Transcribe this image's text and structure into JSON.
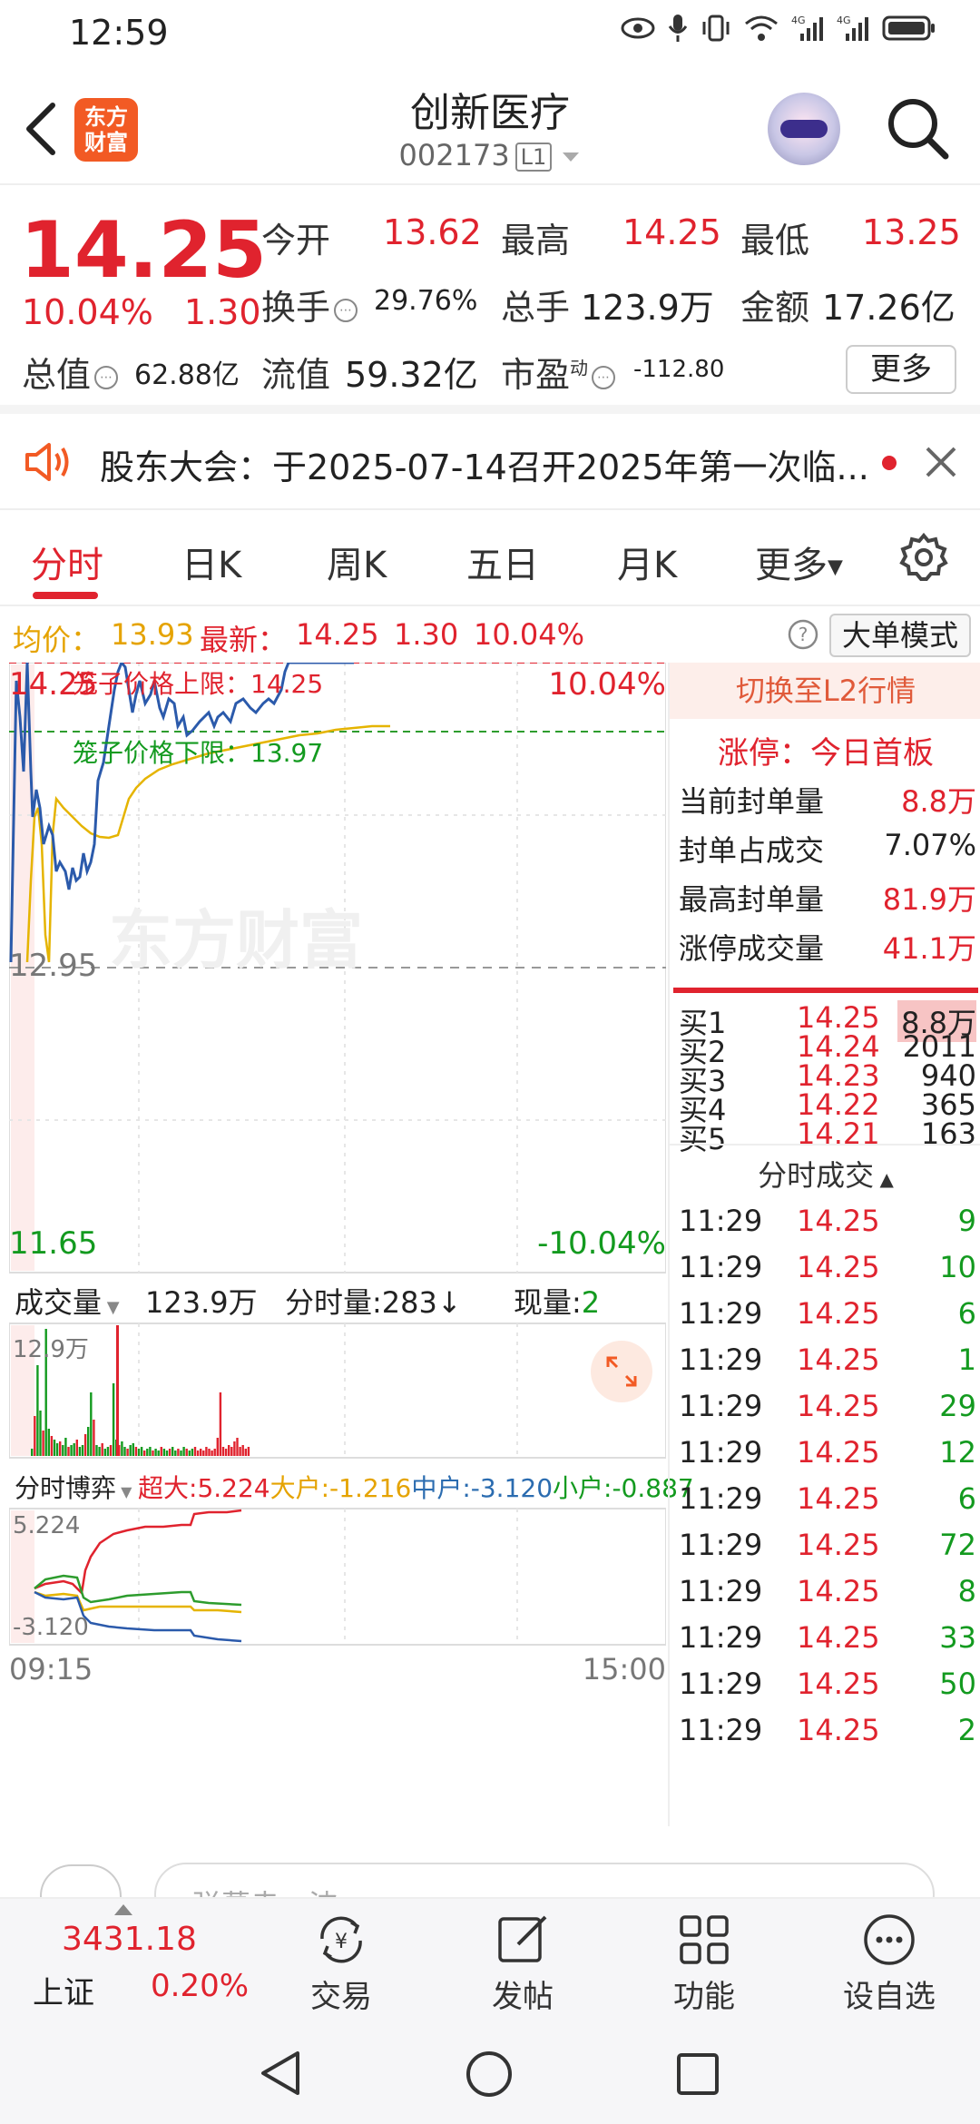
{
  "status": {
    "time": "12:59",
    "net1": "4G",
    "net2": "4G"
  },
  "header": {
    "logo_line1": "东方",
    "logo_line2": "财富",
    "stock_name": "创新医疗",
    "stock_code": "002173",
    "level": "L1"
  },
  "quote": {
    "price": "14.25",
    "change_pct": "10.04%",
    "change": "1.30",
    "open_label": "今开",
    "open": "13.62",
    "high_label": "最高",
    "high": "14.25",
    "low_label": "最低",
    "low": "13.25",
    "turnover_label": "换手",
    "turnover": "29.76%",
    "volume_label": "总手",
    "volume": "123.9万",
    "amount_label": "金额",
    "amount": "17.26亿",
    "mktcap_label": "总值",
    "mktcap": "62.88亿",
    "float_label": "流值",
    "float_cap": "59.32亿",
    "pe_label": "市盈",
    "pe_sup": "动",
    "pe": "-112.80",
    "more": "更多"
  },
  "notice": {
    "text": "股东大会：于2025-07-14召开2025年第一次临..."
  },
  "tabs": [
    "分时",
    "日K",
    "周K",
    "五日",
    "月K",
    "更多"
  ],
  "summary": {
    "avg_label": "均价：",
    "avg": "13.93",
    "latest_label": "最新：",
    "latest": "14.25",
    "change": "1.30",
    "pct": "10.04%",
    "bigorder": "大单模式"
  },
  "chart": {
    "price_top": "14.25",
    "price_mid": "12.95",
    "price_bottom": "11.65",
    "pct_top": "10.04%",
    "pct_bottom": "-10.04%",
    "cage_upper_label": "笼子价格上限：",
    "cage_upper": "14.25",
    "cage_lower_label": "笼子价格下限：",
    "cage_lower": "13.97",
    "watermark": "东方财富",
    "vol_selector": "成交量",
    "vol_total": "123.9万",
    "vol_minute_label": "分时量:",
    "vol_minute": "283",
    "vol_now_label": "现量:",
    "vol_now": "2",
    "vol_max": "12.9万",
    "flow_selector": "分时博弈",
    "flow_super_label": "超大:",
    "flow_super": "5.224",
    "flow_large_label": "大户:",
    "flow_large": "-1.216",
    "flow_mid_label": "中户:",
    "flow_mid": "-3.120",
    "flow_small_label": "小户:",
    "flow_small": "-0.887",
    "flow_top": "5.224",
    "flow_bottom": "-3.120",
    "time_start": "09:15",
    "time_end": "15:00"
  },
  "side": {
    "switch_l2": "切换至L2行情",
    "limit_title": "涨停：今日首板",
    "stats": [
      {
        "label": "当前封单量",
        "value": "8.8万"
      },
      {
        "label": "封单占成交",
        "value": "7.07%"
      },
      {
        "label": "最高封单量",
        "value": "81.9万"
      },
      {
        "label": "涨停成交量",
        "value": "41.1万"
      }
    ],
    "bids": [
      {
        "label": "买1",
        "price": "14.25",
        "vol": "8.8万"
      },
      {
        "label": "买2",
        "price": "14.24",
        "vol": "2011"
      },
      {
        "label": "买3",
        "price": "14.23",
        "vol": "940"
      },
      {
        "label": "买4",
        "price": "14.22",
        "vol": "365"
      },
      {
        "label": "买5",
        "price": "14.21",
        "vol": "163"
      }
    ],
    "ticks_title": "分时成交",
    "ticks": [
      {
        "time": "11:29",
        "price": "14.25",
        "vol": "9"
      },
      {
        "time": "11:29",
        "price": "14.25",
        "vol": "10"
      },
      {
        "time": "11:29",
        "price": "14.25",
        "vol": "6"
      },
      {
        "time": "11:29",
        "price": "14.25",
        "vol": "1"
      },
      {
        "time": "11:29",
        "price": "14.25",
        "vol": "29"
      },
      {
        "time": "11:29",
        "price": "14.25",
        "vol": "12"
      },
      {
        "time": "11:29",
        "price": "14.25",
        "vol": "6"
      },
      {
        "time": "11:29",
        "price": "14.25",
        "vol": "72"
      },
      {
        "time": "11:29",
        "price": "14.25",
        "vol": "8"
      },
      {
        "time": "11:29",
        "price": "14.25",
        "vol": "33"
      },
      {
        "time": "11:29",
        "price": "14.25",
        "vol": "50"
      },
      {
        "time": "11:29",
        "price": "14.25",
        "vol": "2"
      }
    ]
  },
  "comment": {
    "placeholder": "弹幕走一波"
  },
  "bottom_nav": {
    "index_value": "3431.18",
    "index_name": "上证",
    "index_pct": "0.20%",
    "trade": "交易",
    "post": "发帖",
    "func": "功能",
    "watch": "设自选"
  },
  "colors": {
    "up": "#e0232e",
    "down": "#139a1f",
    "brand": "#f25a24"
  }
}
